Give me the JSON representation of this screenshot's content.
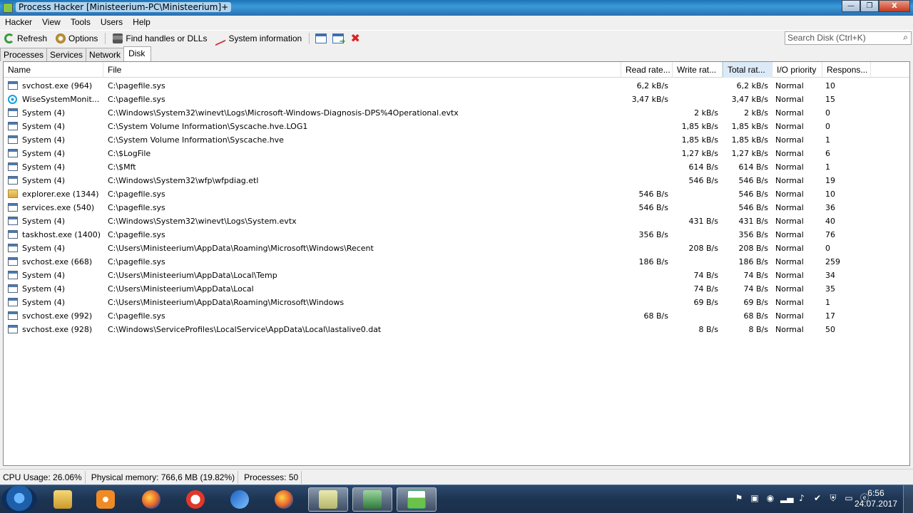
{
  "window": {
    "title": "Process Hacker [Ministeerium-PC\\Ministeerium]+",
    "min_glyph": "—",
    "max_glyph": "❐",
    "close_glyph": "X"
  },
  "menu": [
    "Hacker",
    "View",
    "Tools",
    "Users",
    "Help"
  ],
  "toolbar": {
    "refresh_label": "Refresh",
    "options_label": "Options",
    "find_label": "Find handles or DLLs",
    "sysinfo_label": "System information",
    "close_glyph": "✖",
    "search_placeholder": "Search Disk (Ctrl+K)"
  },
  "tabs": [
    "Processes",
    "Services",
    "Network",
    "Disk"
  ],
  "active_tab": "Disk",
  "columns": [
    "Name",
    "File",
    "Read rate...",
    "Write rat...",
    "Total rat...",
    "I/O priority",
    "Respons..."
  ],
  "sorted_column": "Total rat...",
  "rows": [
    {
      "icon": "window",
      "name": "svchost.exe (964)",
      "file": "C:\\pagefile.sys",
      "read": "6,2 kB/s",
      "write": "",
      "total": "6,2 kB/s",
      "priority": "Normal",
      "response": "10"
    },
    {
      "icon": "wise",
      "name": "WiseSystemMonit...",
      "file": "C:\\pagefile.sys",
      "read": "3,47 kB/s",
      "write": "",
      "total": "3,47 kB/s",
      "priority": "Normal",
      "response": "15"
    },
    {
      "icon": "window",
      "name": "System (4)",
      "file": "C:\\Windows\\System32\\winevt\\Logs\\Microsoft-Windows-Diagnosis-DPS%4Operational.evtx",
      "read": "",
      "write": "2 kB/s",
      "total": "2 kB/s",
      "priority": "Normal",
      "response": "0"
    },
    {
      "icon": "window",
      "name": "System (4)",
      "file": "C:\\System Volume Information\\Syscache.hve.LOG1",
      "read": "",
      "write": "1,85 kB/s",
      "total": "1,85 kB/s",
      "priority": "Normal",
      "response": "0"
    },
    {
      "icon": "window",
      "name": "System (4)",
      "file": "C:\\System Volume Information\\Syscache.hve",
      "read": "",
      "write": "1,85 kB/s",
      "total": "1,85 kB/s",
      "priority": "Normal",
      "response": "1"
    },
    {
      "icon": "window",
      "name": "System (4)",
      "file": "C:\\$LogFile",
      "read": "",
      "write": "1,27 kB/s",
      "total": "1,27 kB/s",
      "priority": "Normal",
      "response": "6"
    },
    {
      "icon": "window",
      "name": "System (4)",
      "file": "C:\\$Mft",
      "read": "",
      "write": "614 B/s",
      "total": "614 B/s",
      "priority": "Normal",
      "response": "1"
    },
    {
      "icon": "window",
      "name": "System (4)",
      "file": "C:\\Windows\\System32\\wfp\\wfpdiag.etl",
      "read": "",
      "write": "546 B/s",
      "total": "546 B/s",
      "priority": "Normal",
      "response": "19"
    },
    {
      "icon": "explorer",
      "name": "explorer.exe (1344)",
      "file": "C:\\pagefile.sys",
      "read": "546 B/s",
      "write": "",
      "total": "546 B/s",
      "priority": "Normal",
      "response": "10"
    },
    {
      "icon": "window",
      "name": "services.exe (540)",
      "file": "C:\\pagefile.sys",
      "read": "546 B/s",
      "write": "",
      "total": "546 B/s",
      "priority": "Normal",
      "response": "36"
    },
    {
      "icon": "window",
      "name": "System (4)",
      "file": "C:\\Windows\\System32\\winevt\\Logs\\System.evtx",
      "read": "",
      "write": "431 B/s",
      "total": "431 B/s",
      "priority": "Normal",
      "response": "40"
    },
    {
      "icon": "window",
      "name": "taskhost.exe (1400)",
      "file": "C:\\pagefile.sys",
      "read": "356 B/s",
      "write": "",
      "total": "356 B/s",
      "priority": "Normal",
      "response": "76"
    },
    {
      "icon": "window",
      "name": "System (4)",
      "file": "C:\\Users\\Ministeerium\\AppData\\Roaming\\Microsoft\\Windows\\Recent",
      "read": "",
      "write": "208 B/s",
      "total": "208 B/s",
      "priority": "Normal",
      "response": "0"
    },
    {
      "icon": "window",
      "name": "svchost.exe (668)",
      "file": "C:\\pagefile.sys",
      "read": "186 B/s",
      "write": "",
      "total": "186 B/s",
      "priority": "Normal",
      "response": "259"
    },
    {
      "icon": "window",
      "name": "System (4)",
      "file": "C:\\Users\\Ministeerium\\AppData\\Local\\Temp",
      "read": "",
      "write": "74 B/s",
      "total": "74 B/s",
      "priority": "Normal",
      "response": "34"
    },
    {
      "icon": "window",
      "name": "System (4)",
      "file": "C:\\Users\\Ministeerium\\AppData\\Local",
      "read": "",
      "write": "74 B/s",
      "total": "74 B/s",
      "priority": "Normal",
      "response": "35"
    },
    {
      "icon": "window",
      "name": "System (4)",
      "file": "C:\\Users\\Ministeerium\\AppData\\Roaming\\Microsoft\\Windows",
      "read": "",
      "write": "69 B/s",
      "total": "69 B/s",
      "priority": "Normal",
      "response": "1"
    },
    {
      "icon": "window",
      "name": "svchost.exe (992)",
      "file": "C:\\pagefile.sys",
      "read": "68 B/s",
      "write": "",
      "total": "68 B/s",
      "priority": "Normal",
      "response": "17"
    },
    {
      "icon": "window",
      "name": "svchost.exe (928)",
      "file": "C:\\Windows\\ServiceProfiles\\LocalService\\AppData\\Local\\lastalive0.dat",
      "read": "",
      "write": "8 B/s",
      "total": "8 B/s",
      "priority": "Normal",
      "response": "50"
    }
  ],
  "status": {
    "cpu": "CPU Usage: 26.06%",
    "memory": "Physical memory: 766,6 MB (19.82%)",
    "processes": "Processes: 50"
  },
  "taskbar": {
    "apps": [
      "explorer",
      "media-player",
      "firefox",
      "opera",
      "thunderbird",
      "firefox",
      "notes",
      "system-monitor",
      "process-hacker"
    ],
    "active_apps": [
      "notes",
      "system-monitor",
      "process-hacker"
    ],
    "time": "6:56",
    "date": "24.07.2017"
  }
}
